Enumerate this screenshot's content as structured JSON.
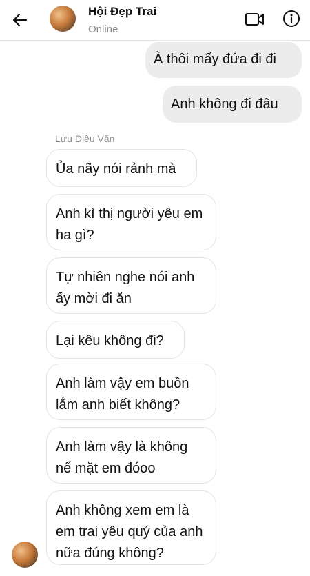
{
  "header": {
    "title": "Hội Đẹp Trai",
    "status": "Online",
    "icons": [
      "arrow-left-icon",
      "video-camera-icon",
      "info-icon"
    ]
  },
  "outgoing": [
    "À thôi mấy đứa đi đi",
    "Anh không đi đâu"
  ],
  "sender_name": "Lưu Diệu Văn",
  "incoming": [
    "Ủa nãy nói rảnh mà",
    "Anh kì thị người yêu em ha gì?",
    "Tự nhiên nghe nói anh ấy mời đi ăn",
    "Lại kêu không đi?",
    "Anh làm vậy em buồn lắm anh biết không?",
    "Anh làm vậy là không nể mặt em đóoo",
    "Anh không xem em là em trai yêu quý của anh nữa đúng không?"
  ],
  "colors": {
    "outgoing_bubble": "#ececec",
    "incoming_border": "#e3e3e3",
    "muted_text": "#8a8a8a"
  }
}
